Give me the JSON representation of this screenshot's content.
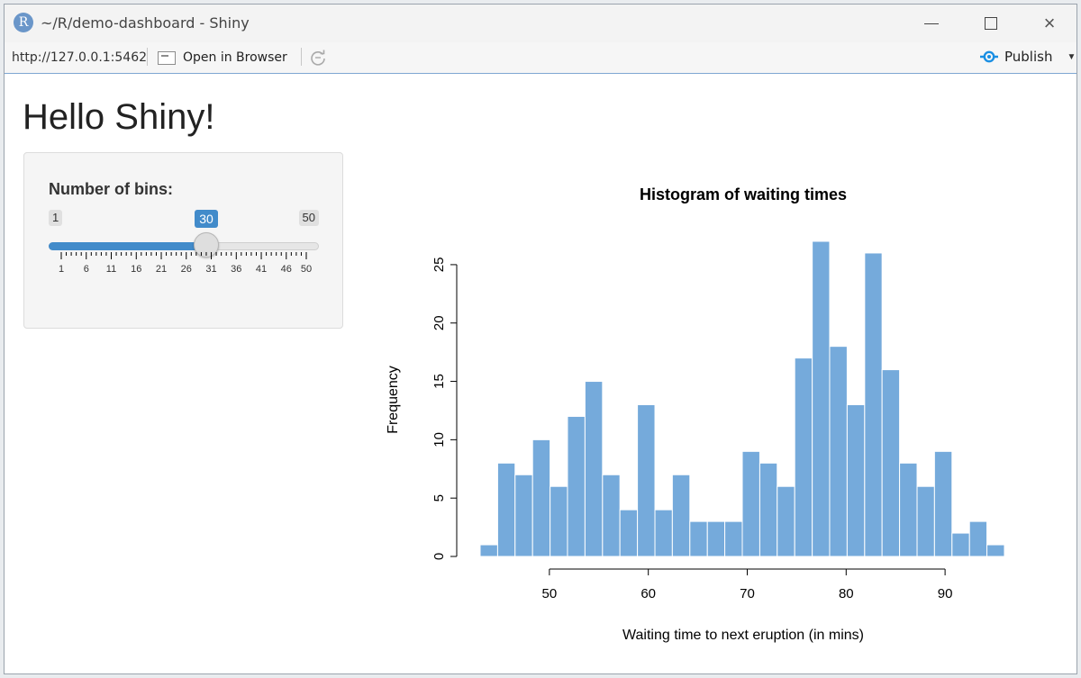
{
  "window": {
    "title": "~/R/demo-dashboard - Shiny",
    "app_icon": "R",
    "buttons": {
      "minimize": "minimize-icon",
      "maximize": "maximize-icon",
      "close": "×"
    }
  },
  "toolbar": {
    "url": "http://127.0.0.1:5462",
    "open_browser_label": "Open in Browser",
    "refresh_icon": "refresh-icon",
    "publish_label": "Publish",
    "publish_icon": "publish-icon",
    "dropdown_caret": "▼",
    "accent_color": "#1a8fe3"
  },
  "page": {
    "title": "Hello Shiny!"
  },
  "sidebar": {
    "bins_label": "Number of bins:",
    "slider": {
      "min": 1,
      "max": 50,
      "value": 30,
      "min_label": "1",
      "max_label": "50",
      "value_label": "30",
      "grid_labels": [
        "1",
        "6",
        "11",
        "16",
        "21",
        "26",
        "31",
        "36",
        "41",
        "46",
        "50"
      ],
      "fill_color": "#428bca"
    }
  },
  "chart_data": {
    "type": "bar",
    "title": "Histogram of waiting times",
    "xlabel": "Waiting time to next eruption (in mins)",
    "ylabel": "Frequency",
    "bin_edges": [
      43.0,
      44.77,
      46.53,
      48.3,
      50.07,
      51.83,
      53.6,
      55.37,
      57.13,
      58.9,
      60.67,
      62.43,
      64.2,
      65.97,
      67.73,
      69.5,
      71.27,
      73.03,
      74.8,
      76.57,
      78.33,
      80.1,
      81.87,
      83.63,
      85.4,
      87.17,
      88.93,
      90.7,
      92.47,
      94.23,
      96.0
    ],
    "values": [
      1,
      8,
      7,
      10,
      6,
      12,
      15,
      7,
      4,
      13,
      4,
      7,
      3,
      3,
      3,
      9,
      8,
      6,
      17,
      27,
      18,
      13,
      26,
      16,
      8,
      6,
      9,
      2,
      3,
      1
    ],
    "xlim": [
      43,
      96
    ],
    "ylim": [
      0,
      27
    ],
    "xticks": [
      50,
      60,
      70,
      80,
      90
    ],
    "yticks": [
      0,
      5,
      10,
      15,
      20,
      25
    ],
    "bar_color": "#75aadb",
    "bar_border": "#ffffff",
    "grid": false
  }
}
